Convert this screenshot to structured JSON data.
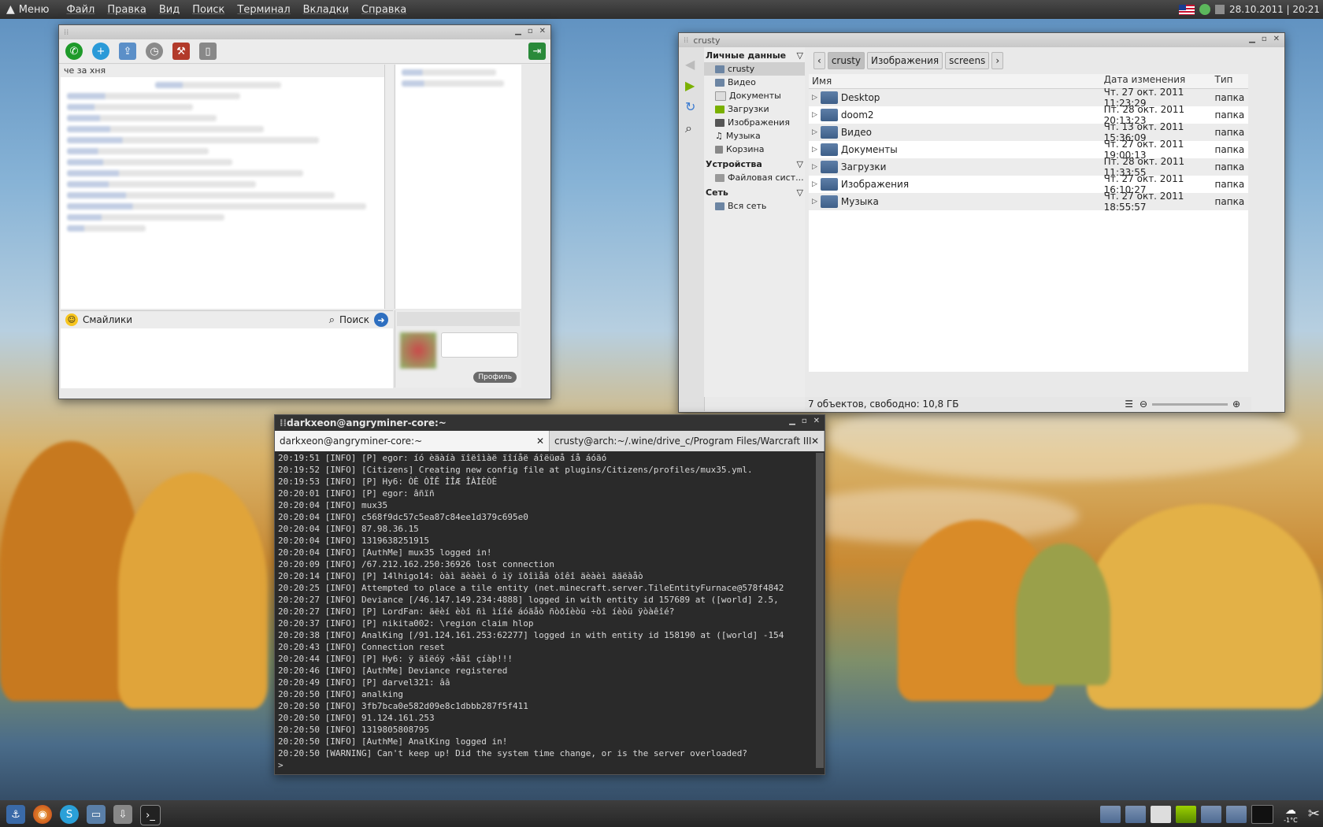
{
  "top_panel": {
    "menu_label": "Меню",
    "menus": [
      "Файл",
      "Правка",
      "Вид",
      "Поиск",
      "Терминал",
      "Вкладки",
      "Справка"
    ],
    "datetime": "28.10.2011 | 20:21"
  },
  "chat": {
    "subject": "че за хня",
    "smileys_label": "Смайлики",
    "search_label": "Поиск",
    "profile_label": "Профиль"
  },
  "file_manager": {
    "title": "crusty",
    "sections": {
      "personal": "Личные данные",
      "devices": "Устройства",
      "network": "Сеть"
    },
    "places": [
      "crusty",
      "Видео",
      "Документы",
      "Загрузки",
      "Изображения",
      "Музыка",
      "Корзина"
    ],
    "devices": [
      "Файловая сист..."
    ],
    "network": [
      "Вся сеть"
    ],
    "breadcrumbs": [
      "crusty",
      "Изображения",
      "screens"
    ],
    "columns": {
      "name": "Имя",
      "date": "Дата изменения",
      "type": "Тип"
    },
    "files": [
      {
        "name": "Desktop",
        "date": "Чт. 27 окт. 2011 11:23:29",
        "type": "папка"
      },
      {
        "name": "doom2",
        "date": "Пт. 28 окт. 2011 20:13:23",
        "type": "папка"
      },
      {
        "name": "Видео",
        "date": "Чт. 13 окт. 2011 15:36:09",
        "type": "папка"
      },
      {
        "name": "Документы",
        "date": "Чт. 27 окт. 2011 19:00:13",
        "type": "папка"
      },
      {
        "name": "Загрузки",
        "date": "Пт. 28 окт. 2011 11:33:55",
        "type": "папка"
      },
      {
        "name": "Изображения",
        "date": "Чт. 27 окт. 2011 16:10:27",
        "type": "папка"
      },
      {
        "name": "Музыка",
        "date": "Чт. 27 окт. 2011 18:55:57",
        "type": "папка"
      }
    ],
    "status": "7 объектов, свободно: 10,8 ГБ"
  },
  "terminal": {
    "title": "darkxeon@angryminer-core:~",
    "tabs": [
      "darkxeon@angryminer-core:~",
      "crusty@arch:~/.wine/drive_c/Program Files/Warcraft III"
    ],
    "lines": [
      "20:19:51 [INFO] [P] egor: íó èäàíà ïîëîìàë ïîíåë áîëüøå íå áóäó",
      "20:19:52 [INFO] [Citizens] Creating new config file at plugins/Citizens/profiles/mux35.yml.",
      "20:19:53 [INFO] [P] Hy6: ÒÈ ÒÎÊ ÌÎÆ ÎÀÌÈÒÈ",
      "20:20:01 [INFO] [P] egor: âñïñ",
      "20:20:04 [INFO] mux35",
      "20:20:04 [INFO] c568f9dc57c5ea87c84ee1d379c695e0",
      "20:20:04 [INFO] 87.98.36.15",
      "20:20:04 [INFO] 1319638251915",
      "20:20:04 [INFO] [AuthMe] mux35 logged in!",
      "20:20:09 [INFO] /67.212.162.250:36926 lost connection",
      "20:20:14 [INFO] [P] 14lhigo14: òàì äèàèì ó ìÿ ïðîìåã òîêî äèàèì ääëàåò",
      "20:20:25 [INFO] Attempted to place a tile entity (net.minecraft.server.TileEntityFurnace@578f4842",
      "20:20:27 [INFO] Deviance [/46.147.149.234:4888] logged in with entity id 157689 at ([world] 2.5,",
      "20:20:27 [INFO] [P] LordFan: äëèí èòî ñì ìíîé áóäåò ñòðîèòü ÷òî íèòü ÿòàêîé?",
      "20:20:37 [INFO] [P] nikita002: \\region claim hlop",
      "20:20:38 [INFO] AnalKing [/91.124.161.253:62277] logged in with entity id 158190 at ([world] -154",
      "20:20:43 [INFO] Connection reset",
      "20:20:44 [INFO] [P] Hy6: ÿ äîëóÿ ÷åãî çíàþ!!!",
      "20:20:46 [INFO] [AuthMe] Deviance registered",
      "20:20:49 [INFO] [P] darvel321: ââ",
      "20:20:50 [INFO] analking",
      "20:20:50 [INFO] 3fb7bca0e582d09e8c1dbbb287f5f411",
      "20:20:50 [INFO] 91.124.161.253",
      "20:20:50 [INFO] 1319805808795",
      "20:20:50 [INFO] [AuthMe] AnalKing logged in!",
      "20:20:50 [WARNING] Can't keep up! Did the system time change, or is the server overloaded?",
      ">"
    ]
  },
  "bottom_panel": {
    "temperature": "-1°C"
  },
  "colors": {
    "panel_dark": "#2e2e2e",
    "terminal_bg": "#2a2a2a",
    "folder_blue": "#4f6b93"
  }
}
